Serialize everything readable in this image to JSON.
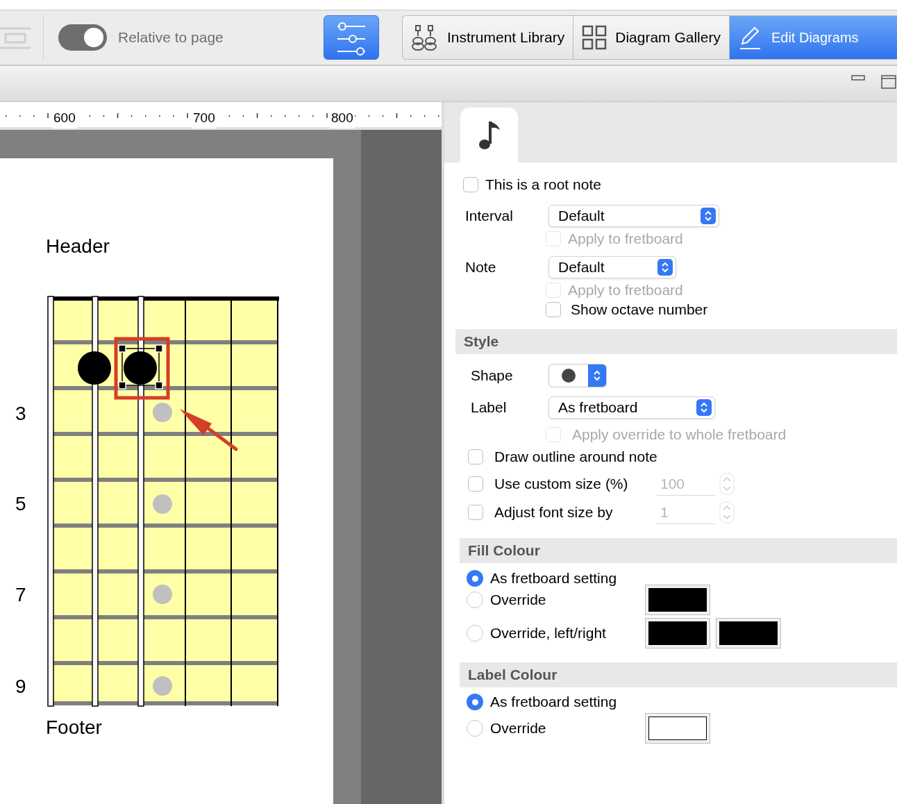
{
  "toolbar": {
    "toggle": {
      "label": "Relative to page",
      "on": true
    },
    "filter_button": {
      "selected": true
    },
    "tabs": [
      {
        "label": "Instrument Library",
        "kind": "instruments",
        "selected": false
      },
      {
        "label": "Diagram Gallery",
        "kind": "gallery",
        "selected": false
      },
      {
        "label": "Edit Diagrams",
        "kind": "edit",
        "selected": true
      }
    ]
  },
  "ruler": {
    "labels": [
      "600",
      "700",
      "800"
    ]
  },
  "canvas": {
    "header": "Header",
    "footer": "Footer",
    "fret_numbers": [
      "3",
      "5",
      "7",
      "9"
    ],
    "notes": [
      {
        "selected": false
      },
      {
        "selected": true
      }
    ]
  },
  "panel": {
    "root_note": {
      "label": "This is a root note",
      "checked": false
    },
    "interval": {
      "label": "Interval",
      "value": "Default",
      "apply": {
        "label": "Apply to fretboard",
        "checked": false,
        "disabled": true
      }
    },
    "note": {
      "label": "Note",
      "value": "Default",
      "apply": {
        "label": "Apply to fretboard",
        "checked": false,
        "disabled": true
      },
      "show_octave": {
        "label": "Show octave number",
        "checked": false
      }
    },
    "style": {
      "title": "Style",
      "shape_label": "Shape",
      "label": {
        "label": "Label",
        "value": "As fretboard"
      },
      "apply_override": {
        "label": "Apply override to whole fretboard",
        "checked": false,
        "disabled": true
      },
      "draw_outline": {
        "label": "Draw outline around note",
        "checked": false
      },
      "custom_size": {
        "label": "Use custom size (%)",
        "checked": false,
        "value": "100"
      },
      "font_adjust": {
        "label": "Adjust font size by",
        "checked": false,
        "value": "1"
      }
    },
    "fill_colour": {
      "title": "Fill Colour",
      "options": [
        {
          "label": "As fretboard setting",
          "selected": true
        },
        {
          "label": "Override",
          "selected": false,
          "swatches": [
            {
              "color": "#000000"
            }
          ]
        },
        {
          "label": "Override, left/right",
          "selected": false,
          "swatches": [
            {
              "color": "#000000"
            },
            {
              "color": "#000000"
            }
          ]
        }
      ]
    },
    "label_colour": {
      "title": "Label Colour",
      "options": [
        {
          "label": "As fretboard setting",
          "selected": true
        },
        {
          "label": "Override",
          "selected": false,
          "swatches": [
            {
              "color": "#ffffff"
            }
          ]
        }
      ]
    }
  }
}
